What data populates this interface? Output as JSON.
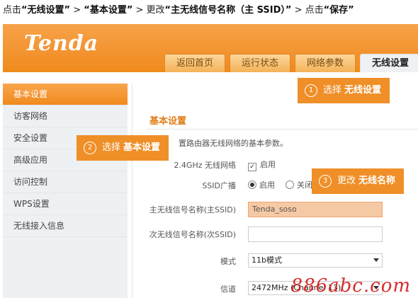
{
  "instruction": {
    "prefix": "点击",
    "step1": "“无线设置”",
    "sep1": " > ",
    "step2": "“基本设置”",
    "sep2": " > 更改",
    "step3": "“主无线信号名称（主 SSID）”",
    "sep3": " > 点击",
    "step4": "“保存”"
  },
  "brand": {
    "logo": "Tenda",
    "accent": "#f08a1d"
  },
  "tabs": [
    {
      "label": "返回首页"
    },
    {
      "label": "运行状态"
    },
    {
      "label": "网络参数"
    },
    {
      "label": "无线设置",
      "active": true
    }
  ],
  "sidebar": {
    "items": [
      {
        "label": "基本设置",
        "active": true
      },
      {
        "label": "访客网络"
      },
      {
        "label": "安全设置"
      },
      {
        "label": "高级应用"
      },
      {
        "label": "访问控制"
      },
      {
        "label": "WPS设置"
      },
      {
        "label": "无线接入信息"
      }
    ]
  },
  "content": {
    "section_title": "基本设置",
    "description": "置路由器无线网络的基本参数。",
    "wireless_label": "2.4GHz 无线网络",
    "wireless_enable": "启用",
    "ssid_broadcast_label": "SSID广播",
    "ssid_on": "启用",
    "ssid_off": "关闭",
    "primary_ssid_label": "主无线信号名称(主SSID)",
    "primary_ssid_value": "Tenda_soso",
    "secondary_ssid_label": "次无线信号名称(次SSID)",
    "secondary_ssid_value": "",
    "mode_label": "模式",
    "mode_value": "11b模式",
    "channel_label": "信道",
    "channel_value": "2472MHz (Channel 13)"
  },
  "callouts": {
    "c1": {
      "num": "1",
      "text": "选择",
      "bold": "无线设置"
    },
    "c2": {
      "num": "2",
      "text": "选择",
      "bold": "基本设置"
    },
    "c3": {
      "num": "3",
      "text": "更改",
      "bold": "无线名称"
    }
  },
  "watermark": "886abc.com"
}
